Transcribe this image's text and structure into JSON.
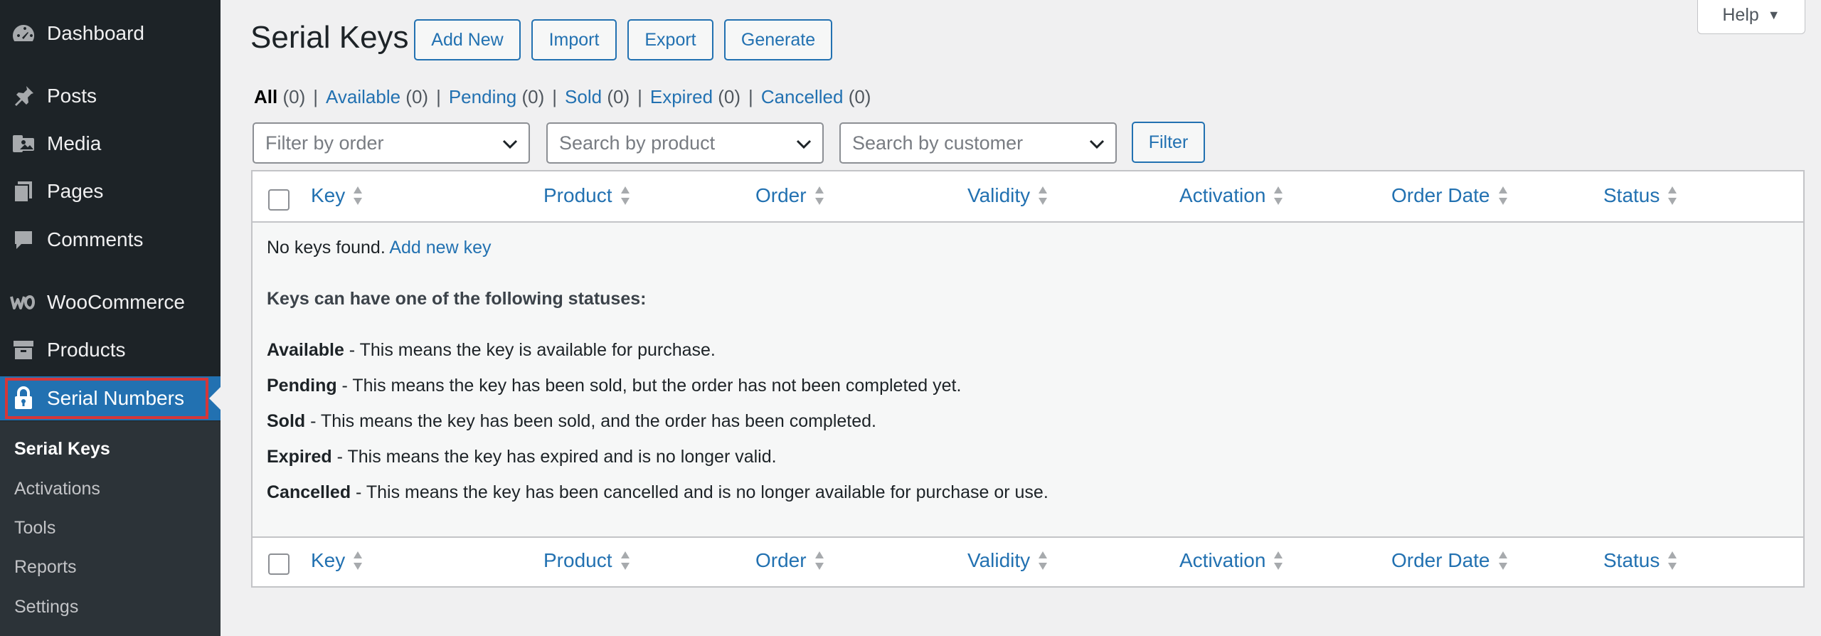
{
  "sidebar": {
    "items": [
      {
        "label": "Dashboard",
        "icon": "dashboard-icon"
      },
      {
        "label": "Posts",
        "icon": "pin-icon"
      },
      {
        "label": "Media",
        "icon": "media-icon"
      },
      {
        "label": "Pages",
        "icon": "pages-icon"
      },
      {
        "label": "Comments",
        "icon": "comments-icon"
      },
      {
        "label": "WooCommerce",
        "icon": "woocommerce-icon"
      },
      {
        "label": "Products",
        "icon": "archive-icon"
      },
      {
        "label": "Serial Numbers",
        "icon": "lock-icon"
      }
    ],
    "submenu": [
      "Serial Keys",
      "Activations",
      "Tools",
      "Reports",
      "Settings"
    ]
  },
  "header": {
    "title": "Serial Keys",
    "buttons": [
      "Add New",
      "Import",
      "Export",
      "Generate"
    ],
    "help": "Help"
  },
  "status_links": [
    {
      "label": "All",
      "count": "(0)"
    },
    {
      "label": "Available",
      "count": "(0)"
    },
    {
      "label": "Pending",
      "count": "(0)"
    },
    {
      "label": "Sold",
      "count": "(0)"
    },
    {
      "label": "Expired",
      "count": "(0)"
    },
    {
      "label": "Cancelled",
      "count": "(0)"
    }
  ],
  "filters": {
    "order_placeholder": "Filter by order",
    "product_placeholder": "Search by product",
    "customer_placeholder": "Search by customer",
    "button": "Filter"
  },
  "table": {
    "columns": [
      "Key",
      "Product",
      "Order",
      "Validity",
      "Activation",
      "Order Date",
      "Status"
    ],
    "empty_text": "No keys found.",
    "empty_link": "Add new key",
    "statuses_heading": "Keys can have one of the following statuses:",
    "statuses": [
      {
        "name": "Available",
        "desc": " - This means the key is available for purchase."
      },
      {
        "name": "Pending",
        "desc": " - This means the key has been sold, but the order has not been completed yet."
      },
      {
        "name": "Sold",
        "desc": " - This means the key has been sold, and the order has been completed."
      },
      {
        "name": "Expired",
        "desc": " - This means the key has expired and is no longer valid."
      },
      {
        "name": "Cancelled",
        "desc": " - This means the key has been cancelled and is no longer available for purchase or use."
      }
    ]
  },
  "colors": {
    "sidebar_bg": "#1d2327",
    "submenu_bg": "#2c3338",
    "accent": "#2271b1",
    "highlight_outline": "#d63638"
  }
}
